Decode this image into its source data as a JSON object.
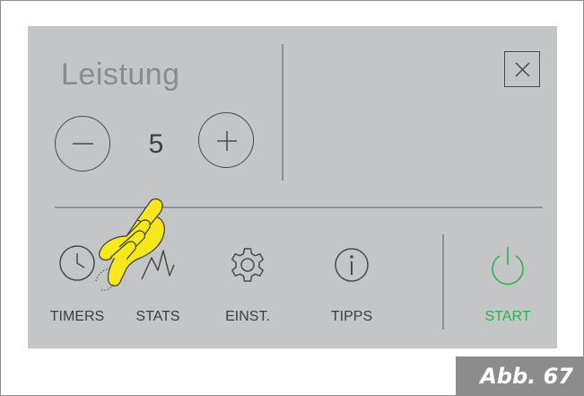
{
  "panel": {
    "title": "Leistung",
    "power_value": "5"
  },
  "nav": {
    "items": [
      {
        "label": "TIMERS",
        "icon": "timer-icon"
      },
      {
        "label": "STATS",
        "icon": "stats-icon"
      },
      {
        "label": "EINST.",
        "icon": "settings-icon"
      },
      {
        "label": "TIPPS",
        "icon": "info-icon"
      }
    ],
    "start": {
      "label": "START",
      "icon": "power-icon"
    }
  },
  "figure_label": "Abb. 67",
  "colors": {
    "panel_bg": "#c4c5c6",
    "text_dark": "#3e3e3e",
    "title_text": "#8a8b8d",
    "start_green": "#2fb24a",
    "hand_yellow": "#f6e81c",
    "badge_bg": "#8c8c8c"
  }
}
